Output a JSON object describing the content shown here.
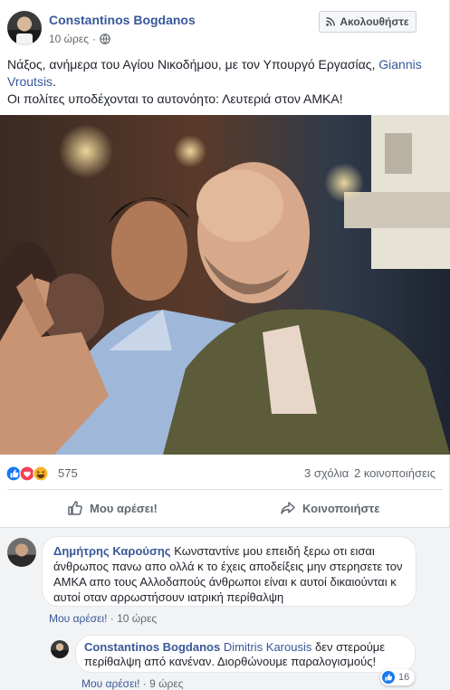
{
  "post": {
    "author": "Constantinos Bogdanos",
    "time": "10 ώρες",
    "separator": "·",
    "follow_label": "Ακολουθήστε",
    "text_line1": "Νάξος, ανήμερα του Αγίου Νικοδήμου, με τον Υπουργό Εργασίας, ",
    "text_tag": "Giannis Vroutsis",
    "text_after_tag": ".",
    "text_line2": "Οι πολίτες υποδέχονται το αυτονόητο: Λευτεριά στον ΑΜΚΑ!"
  },
  "stats": {
    "reactions": "575",
    "comments": "3 σχόλια",
    "shares": "2 κοινοποιήσεις"
  },
  "actions": {
    "like": "Μου αρέσει!",
    "share": "Κοινοποιήστε"
  },
  "comments": [
    {
      "author": "Δημήτρης Καρούσης",
      "text": "Κωνσταντίνε μου επειδή ξερω οτι εισαι άνθρωπος πανω απο ολλά κ το έχεις αποδείξεις μην στερησετε τον ΑΜΚΑ απο τους Αλλοδαπούς άνθρωποι είναι κ αυτοί δικαιούνται κ αυτοί οταν αρρωστήσουν ιατρική περίθαλψη",
      "like_label": "Μου αρέσει!",
      "sep": " · ",
      "time": "10 ώρες"
    },
    {
      "author": "Constantinos Bogdanos",
      "mention": "Dimitris Karousis",
      "text": " δεν στερούμε περίθαλψη από κανέναν. Διορθώνουμε παραλογισμούς!",
      "likes": "16",
      "like_label": "Μου αρέσει!",
      "sep": " · ",
      "time": "9 ώρες"
    }
  ],
  "icons": {
    "globe": "globe-icon",
    "follow": "rss-icon",
    "like": "thumbs-up-icon",
    "share": "share-arrow-icon",
    "reaction_like": "like-reaction-icon",
    "reaction_love": "love-reaction-icon",
    "reaction_haha": "haha-reaction-icon"
  },
  "colors": {
    "link": "#385898",
    "like_blue": "#1877f2",
    "love_red": "#f33e58",
    "haha_yellow": "#f7b125"
  }
}
